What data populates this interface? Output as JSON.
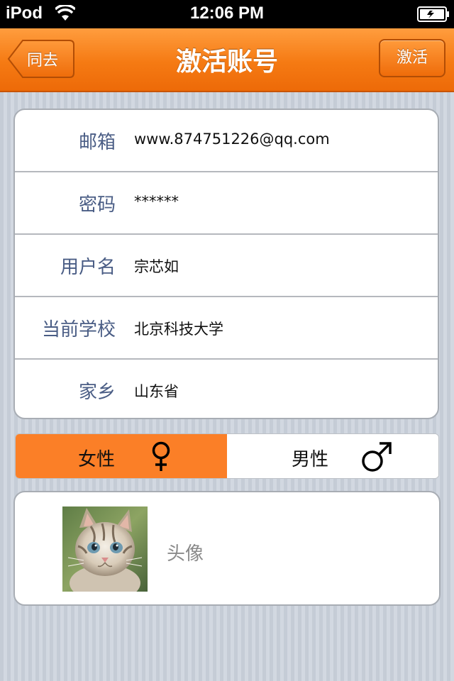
{
  "status_bar": {
    "carrier": "iPod",
    "time": "12:06 PM"
  },
  "nav": {
    "title": "激活账号",
    "back_label": "同去",
    "activate_label": "激活"
  },
  "form": {
    "rows": [
      {
        "label": "邮箱",
        "value": "www.874751226@qq.com"
      },
      {
        "label": "密码",
        "value": "******"
      },
      {
        "label": "用户名",
        "value": "宗芯如"
      },
      {
        "label": "当前学校",
        "value": "北京科技大学"
      },
      {
        "label": "家乡",
        "value": "山东省"
      }
    ]
  },
  "gender": {
    "female_label": "女性",
    "male_label": "男性",
    "selected": "女性"
  },
  "avatar": {
    "label": "头像"
  },
  "colors": {
    "accent": "#f57a13",
    "selected_segment": "#fb7f27",
    "label_text": "#4a5d85"
  }
}
